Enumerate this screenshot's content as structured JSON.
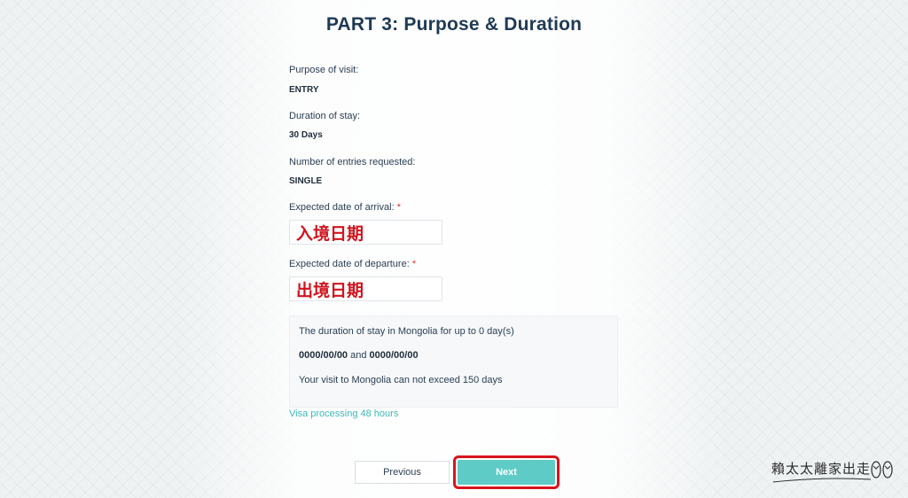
{
  "header": {
    "title": "PART 3: Purpose & Duration"
  },
  "form": {
    "purpose": {
      "label": "Purpose of visit:",
      "value": "ENTRY"
    },
    "duration": {
      "label": "Duration of stay:",
      "value": "30 Days"
    },
    "entries": {
      "label": "Number of entries requested:",
      "value": "SINGLE"
    },
    "arrival": {
      "label": "Expected date of arrival:",
      "required_mark": "*",
      "value": "入境日期"
    },
    "departure": {
      "label": "Expected date of departure:",
      "required_mark": "*",
      "value": "出境日期"
    }
  },
  "info": {
    "line1": "The duration of stay in Mongolia for up to 0 day(s)",
    "date_from": "0000/00/00",
    "joiner": " and ",
    "date_to": "0000/00/00",
    "line3": "Your visit to Mongolia can not exceed 150 days"
  },
  "processing_note": "Visa processing 48 hours",
  "nav": {
    "previous_label": "Previous",
    "next_label": "Next"
  },
  "watermark": {
    "text": "賴太太離家出走"
  },
  "colors": {
    "accent": "#5fcbc6",
    "highlight": "#d8141c",
    "annotation_text": "#d0141e",
    "link": "#3fb9b5"
  }
}
